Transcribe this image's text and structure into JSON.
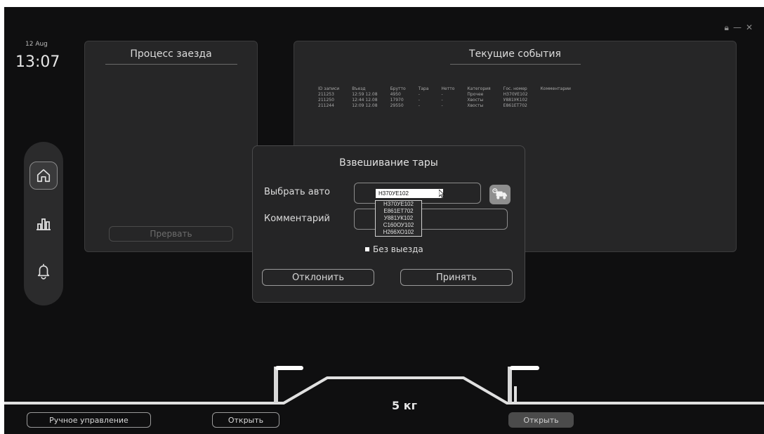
{
  "header": {
    "date": "12 Aug",
    "time": "13:07",
    "window_controls": [
      "lock-icon",
      "minimize-icon",
      "close-icon"
    ]
  },
  "process_panel": {
    "title": "Процесс заезда",
    "abort_label": "Прервать"
  },
  "events_panel": {
    "title": "Текущие события",
    "columns": [
      "ID записи",
      "Въезд",
      "Брутто",
      "Тара",
      "Нетто",
      "Категория",
      "Гос. номер",
      "Комментарии"
    ],
    "rows": [
      [
        "211253",
        "12:59 12.08",
        "4950",
        "-",
        "-",
        "Прочее",
        "Н370УЕ102",
        ""
      ],
      [
        "211250",
        "12:44 12.08",
        "17970",
        "-",
        "-",
        "Хвосты",
        "У881УК102",
        ""
      ],
      [
        "211244",
        "12:09 12.08",
        "29550",
        "-",
        "-",
        "Хвосты",
        "Е861ЕТ702",
        ""
      ]
    ]
  },
  "sidenav": {
    "items": [
      {
        "icon": "home-icon",
        "active": true
      },
      {
        "icon": "bar-chart-icon",
        "active": false
      },
      {
        "icon": "bell-icon",
        "active": false
      }
    ]
  },
  "dialog": {
    "title": "Взвешивание тары",
    "select_car_label": "Выбрать авто",
    "selected_car": "Н370УЕ102",
    "car_options": [
      "Н370УЕ102",
      "Е861ЕТ702",
      "У881УК102",
      "С160ОУ102",
      "Н266ХО102"
    ],
    "comment_label": "Комментарий",
    "comment_value": "",
    "no_exit_label": "Без выезда",
    "reject_label": "Отклонить",
    "accept_label": "Принять"
  },
  "scale": {
    "weight": "5 кг"
  },
  "bottom_bar": {
    "manual_label": "Ручное управление",
    "open_left_label": "Открыть",
    "open_right_label": "Открыть"
  },
  "colors": {
    "background": "#0f0f10",
    "panel": "#262627",
    "accent_button": "#8e8e8e"
  }
}
